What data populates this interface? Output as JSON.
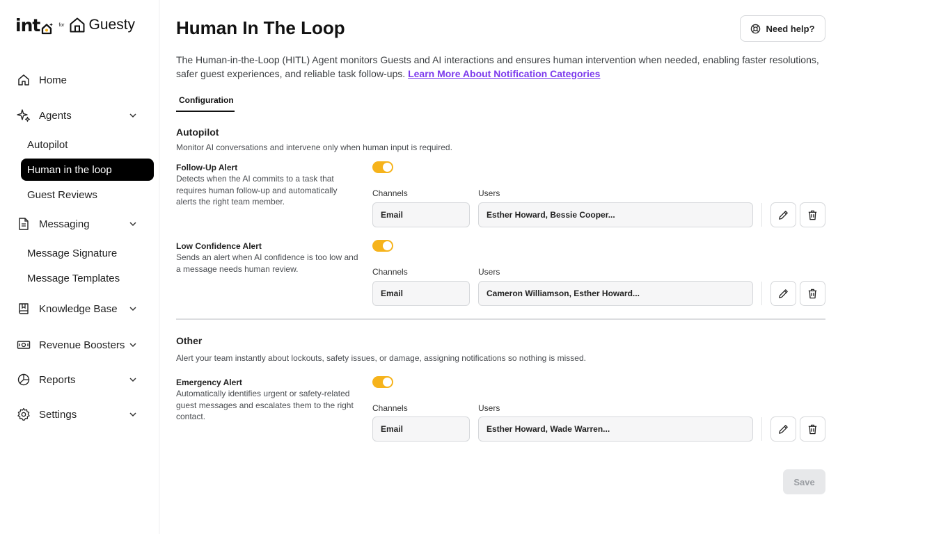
{
  "logo": {
    "into": "int",
    "for": "for",
    "guesty": "Guesty"
  },
  "sidebar": {
    "home": "Home",
    "agents": "Agents",
    "autopilot": "Autopilot",
    "human_in_loop": "Human in the loop",
    "guest_reviews": "Guest Reviews",
    "messaging": "Messaging",
    "message_signature": "Message Signature",
    "message_templates": "Message Templates",
    "knowledge_base": "Knowledge Base",
    "revenue_boosters": "Revenue Boosters",
    "reports": "Reports",
    "settings": "Settings"
  },
  "header": {
    "title": "Human In The Loop",
    "help": "Need help?",
    "description": "The Human-in-the-Loop (HITL) Agent monitors Guests and AI interactions and ensures human intervention when needed, enabling faster resolutions, safer guest experiences, and reliable task follow-ups. ",
    "learn_more": "Learn More About Notification Categories"
  },
  "tabs": {
    "configuration": "Configuration"
  },
  "autopilot": {
    "title": "Autopilot",
    "description": "Monitor AI conversations and intervene only when human input is required.",
    "alerts": [
      {
        "title": "Follow-Up Alert",
        "description": "Detects when the AI commits to a task that requires human follow-up and automatically alerts the right team member.",
        "enabled": true,
        "channels_label": "Channels",
        "users_label": "Users",
        "channel": "Email",
        "users": "Esther Howard, Bessie Cooper..."
      },
      {
        "title": "Low Confidence Alert",
        "description": "Sends an alert when AI confidence is too low and a message needs human review.",
        "enabled": true,
        "channels_label": "Channels",
        "users_label": "Users",
        "channel": "Email",
        "users": "Cameron Williamson, Esther Howard..."
      }
    ]
  },
  "other": {
    "title": "Other",
    "description": "Alert your team instantly about lockouts, safety issues, or damage, assigning notifications so nothing is missed.",
    "alerts": [
      {
        "title": "Emergency Alert",
        "description": "Automatically identifies urgent or safety-related guest messages and escalates them to the right contact.",
        "enabled": true,
        "channels_label": "Channels",
        "users_label": "Users",
        "channel": "Email",
        "users": "Esther Howard, Wade Warren..."
      }
    ]
  },
  "footer": {
    "save": "Save"
  },
  "colors": {
    "toggle_on": "#f6b31b",
    "link": "#7c3aed",
    "active_nav": "#000000"
  },
  "icons": [
    "home-icon",
    "sparkle-icon",
    "document-icon",
    "book-icon",
    "banknote-icon",
    "pie-chart-icon",
    "gear-icon",
    "lifebuoy-icon",
    "pencil-icon",
    "trash-icon",
    "chevron-down-icon"
  ]
}
